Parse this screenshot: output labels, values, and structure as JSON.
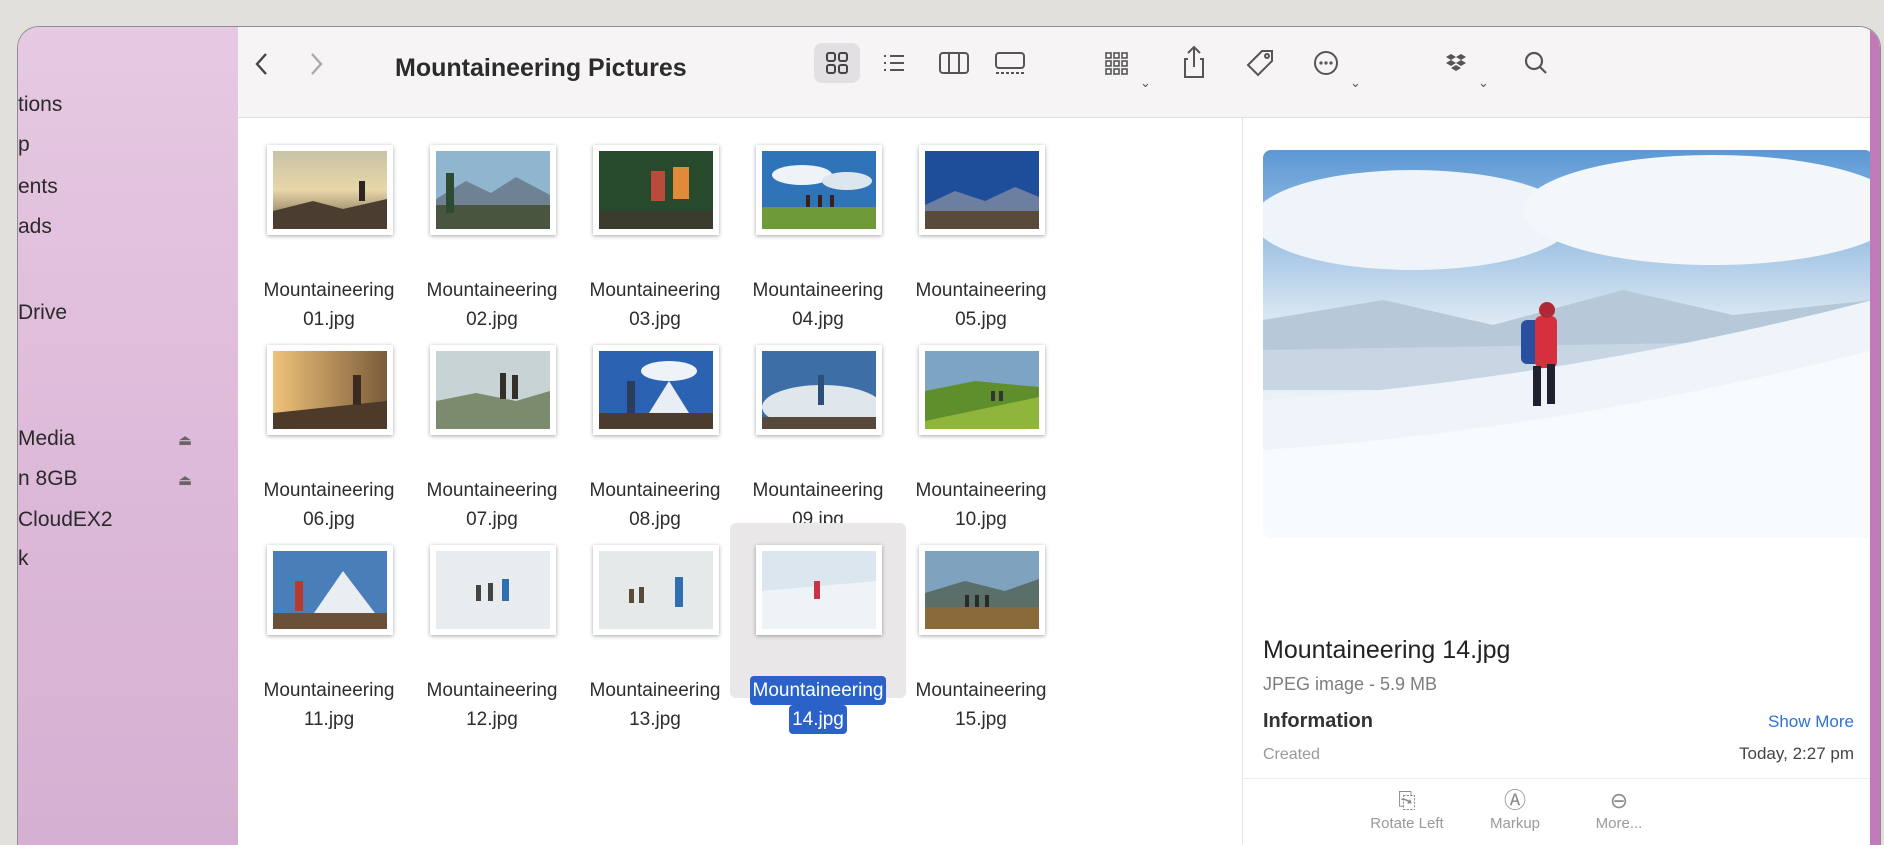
{
  "window": {
    "title": "Mountaineering Pictures"
  },
  "sidebar": {
    "items": [
      {
        "label": "tions"
      },
      {
        "label": "p"
      },
      {
        "label": "ents"
      },
      {
        "label": "ads"
      },
      {
        "label": "Drive"
      },
      {
        "label": "Media"
      },
      {
        "label": "n 8GB"
      },
      {
        "label": "CloudEX2"
      },
      {
        "label": "k"
      }
    ],
    "eject_icon": "eject-icon"
  },
  "toolbar": {
    "back_icon": "chevron-left-icon",
    "forward_icon": "chevron-right-icon",
    "view_modes": [
      "icon-view",
      "list-view",
      "column-view",
      "gallery-view"
    ],
    "active_view": "icon-view"
  },
  "files": [
    {
      "line1": "Mountaineering",
      "line2": "01.jpg"
    },
    {
      "line1": "Mountaineering",
      "line2": "02.jpg"
    },
    {
      "line1": "Mountaineering",
      "line2": "03.jpg"
    },
    {
      "line1": "Mountaineering",
      "line2": "04.jpg"
    },
    {
      "line1": "Mountaineering",
      "line2": "05.jpg"
    },
    {
      "line1": "Mountaineering",
      "line2": "06.jpg"
    },
    {
      "line1": "Mountaineering",
      "line2": "07.jpg"
    },
    {
      "line1": "Mountaineering",
      "line2": "08.jpg"
    },
    {
      "line1": "Mountaineering",
      "line2": "09.jpg"
    },
    {
      "line1": "Mountaineering",
      "line2": "10.jpg"
    },
    {
      "line1": "Mountaineering",
      "line2": "11.jpg"
    },
    {
      "line1": "Mountaineering",
      "line2": "12.jpg"
    },
    {
      "line1": "Mountaineering",
      "line2": "13.jpg"
    },
    {
      "line1": "Mountaineering",
      "line2": "14.jpg"
    },
    {
      "line1": "Mountaineering",
      "line2": "15.jpg"
    }
  ],
  "selected_file_index": 13,
  "preview": {
    "name": "Mountaineering 14.jpg",
    "kind": "JPEG image - 5.9 MB",
    "info_heading": "Information",
    "show_more": "Show More",
    "created_label": "Created",
    "created_value": "Today, 2:27 pm",
    "actions": [
      {
        "label": "Rotate Left",
        "icon": "rotate-left-icon"
      },
      {
        "label": "Markup",
        "icon": "markup-icon"
      },
      {
        "label": "More...",
        "icon": "more-icon"
      }
    ]
  },
  "colors": {
    "sidebar_top": "#e6c9e2",
    "selection": "#2b62c9",
    "link": "#2f71d6"
  }
}
